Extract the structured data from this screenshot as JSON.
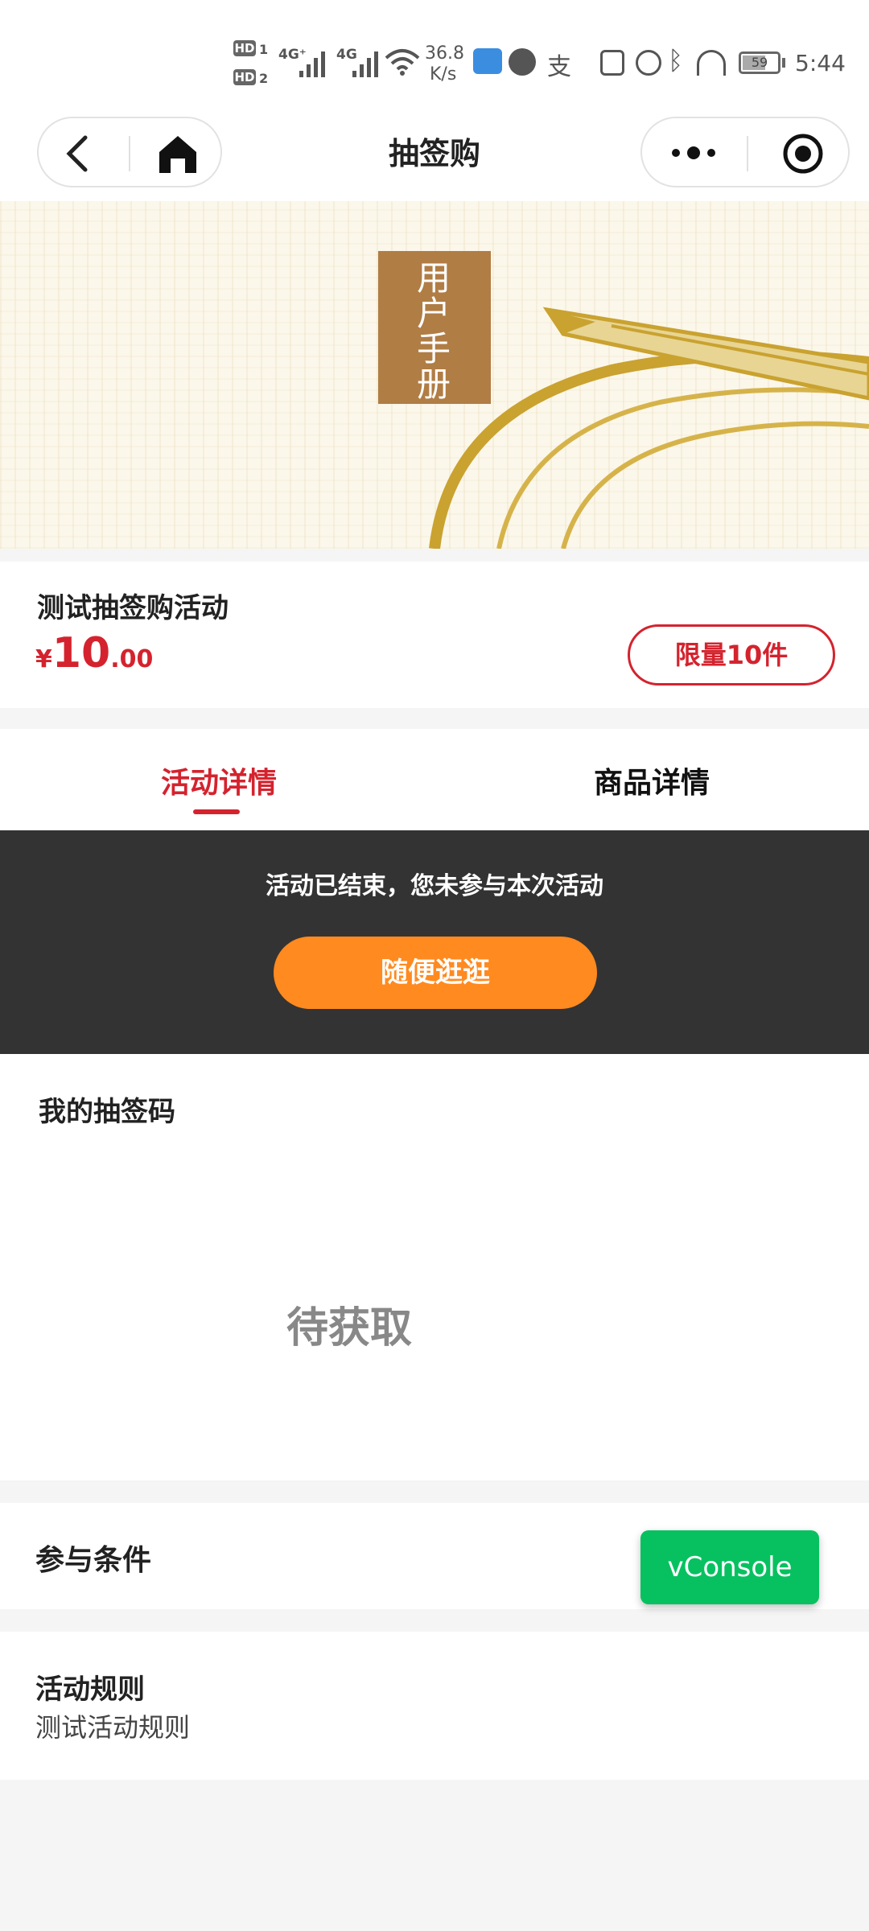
{
  "status_bar": {
    "hd1": "HD",
    "sim1": "1",
    "hd2": "HD",
    "sim2": "2",
    "net1": "4G⁺",
    "net2": "4G",
    "speed_value": "36.8",
    "speed_unit": "K/s",
    "alipay_char": "支",
    "battery": "59",
    "time": "5:44"
  },
  "nav": {
    "title": "抽签购"
  },
  "banner": {
    "lines": [
      "用",
      "户",
      "手",
      "册"
    ]
  },
  "product": {
    "name": "测试抽签购活动",
    "currency": "¥",
    "price_int": "10",
    "price_dec": ".00",
    "limit_label": "限量10件"
  },
  "tabs": [
    {
      "label": "活动详情",
      "active": true
    },
    {
      "label": "商品详情",
      "active": false
    }
  ],
  "ended": {
    "message": "活动已结束，您未参与本次活动",
    "button": "随便逛逛"
  },
  "codes": {
    "title": "我的抽签码",
    "status": "待获取"
  },
  "conditions": {
    "title": "参与条件"
  },
  "rules": {
    "title": "活动规则",
    "text": "测试活动规则"
  },
  "vconsole": {
    "label": "vConsole"
  },
  "colors": {
    "accent_red": "#d4232e",
    "orange_button": "#ff8a1f",
    "vconsole_green": "#07c160",
    "dark_panel": "#333333",
    "banner_brown": "#b07d45"
  }
}
